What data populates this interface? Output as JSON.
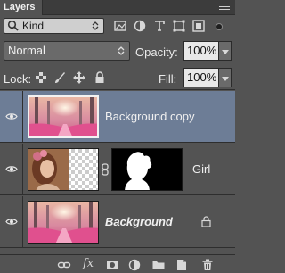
{
  "panel": {
    "tab_label": "Layers",
    "menu_icon": "panel-menu-icon"
  },
  "filter": {
    "kind_label": "Kind",
    "icons": [
      "pixel-filter-icon",
      "adjustment-filter-icon",
      "type-filter-icon",
      "shape-filter-icon",
      "smart-object-filter-icon"
    ]
  },
  "blend": {
    "mode": "Normal",
    "opacity_label": "Opacity:",
    "opacity_value": "100%"
  },
  "lock": {
    "label": "Lock:",
    "fill_label": "Fill:",
    "fill_value": "100%",
    "icons": [
      "lock-transparent-icon",
      "lock-image-icon",
      "lock-position-icon",
      "lock-all-icon"
    ]
  },
  "layers": [
    {
      "name": "Background copy",
      "selected": true,
      "visible": true
    },
    {
      "name": "Girl",
      "selected": false,
      "visible": true,
      "has_mask": true
    },
    {
      "name": "Background",
      "selected": false,
      "visible": true,
      "locked": true
    }
  ],
  "bottom_bar": {
    "fx_label": "fx",
    "icons": [
      "link-layers-icon",
      "add-style-icon",
      "add-mask-icon",
      "adjustment-layer-icon",
      "new-group-icon",
      "new-layer-icon",
      "delete-layer-icon"
    ]
  },
  "colors": {
    "panel_bg": "#535353",
    "selected_row": "#6d7d96",
    "tab_bar": "#3c3c3c"
  }
}
